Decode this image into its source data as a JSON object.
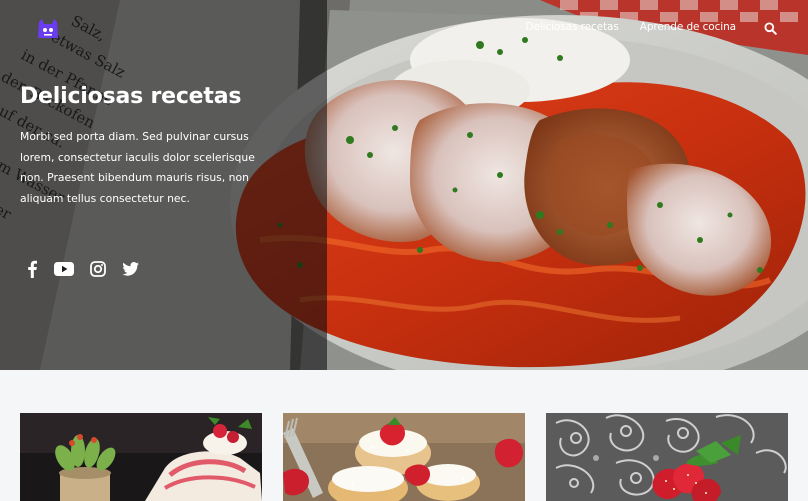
{
  "nav": {
    "items": [
      "Deliciosas recetas",
      "Aprende de cocina"
    ],
    "search_icon": "search-icon"
  },
  "hero": {
    "title": "Deliciosas recetas",
    "text": "Morbi sed porta diam. Sed pulvinar cursus lorem, consectetur iaculis dolor scelerisque non. Praesent bibendum mauris risus, non aliquam tellus consectetur nec.",
    "social_icons": [
      "facebook-icon",
      "youtube-icon",
      "instagram-icon",
      "twitter-icon"
    ],
    "book_text": [
      "Salz,",
      "etwas Salz",
      "in der Pfanne",
      "den Backofen",
      "auf der ca.",
      "dem Wasser",
      "sser"
    ]
  },
  "colors": {
    "logo": "#6a3cf0",
    "overlay": "rgba(12,12,14,0.58)",
    "card_bg": "#f5f6f8"
  },
  "cards": [
    {
      "image": "cake-slice-with-succulent"
    },
    {
      "image": "cream-puffs-with-strawberries"
    },
    {
      "image": "strawberries-on-paisley-pattern"
    }
  ]
}
